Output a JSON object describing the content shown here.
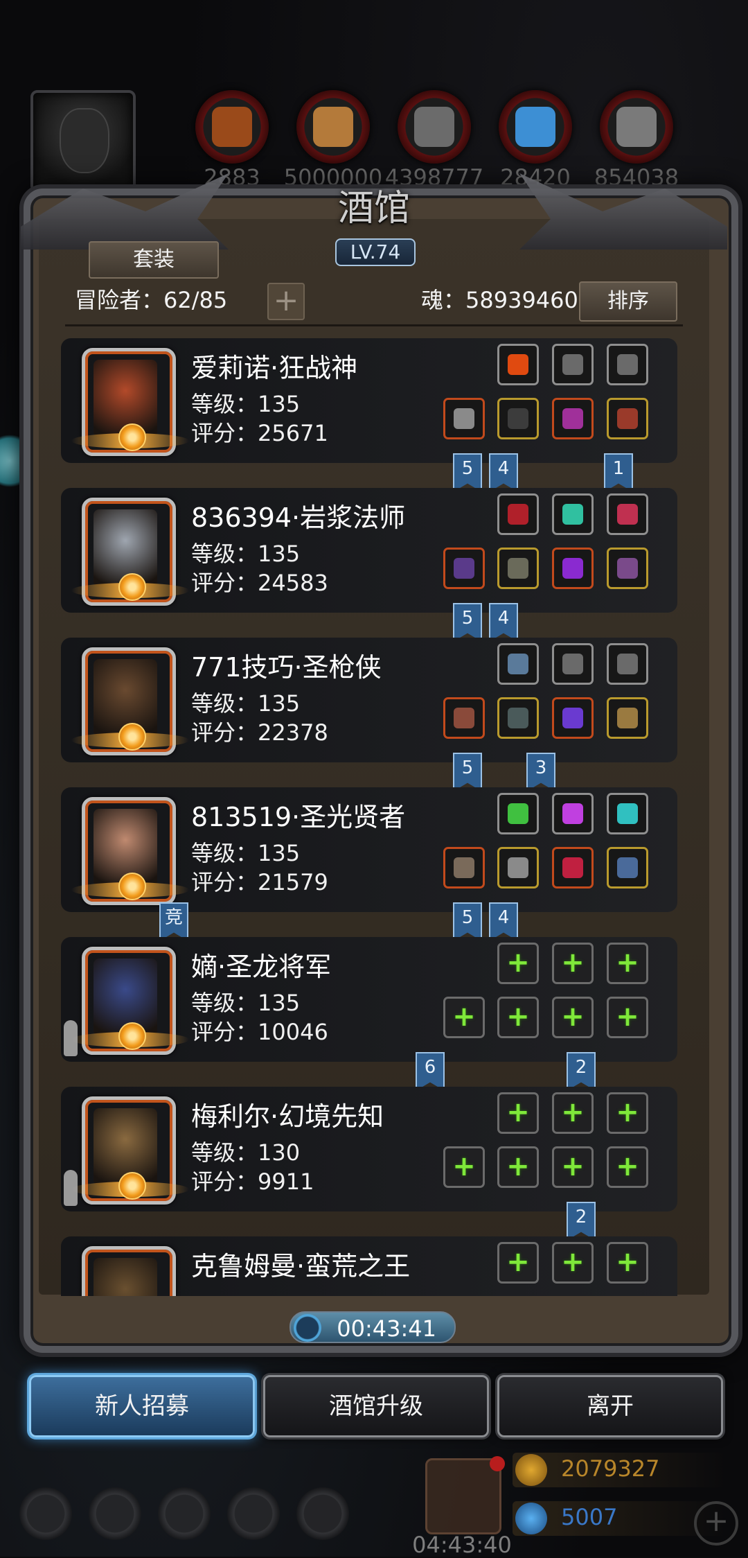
{
  "header": {
    "resources": [
      {
        "icon": "meat-icon",
        "value": "2883",
        "color": "#9a4a1a"
      },
      {
        "icon": "wood-icon",
        "value": "5000000",
        "color": "#b47a3a"
      },
      {
        "icon": "iron-icon",
        "value": "4398777",
        "color": "#6b6b6b"
      },
      {
        "icon": "crystal-icon",
        "value": "28420",
        "color": "#3d8fd4"
      },
      {
        "icon": "stone-icon",
        "value": "854038",
        "color": "#7a7a7a"
      }
    ]
  },
  "tavern": {
    "title": "酒馆",
    "level": "LV.74",
    "set_button": "套装",
    "adventurer_label": "冒险者：62/85",
    "add_button": "+",
    "soul_label": "魂：58939460",
    "sort_button": "排序"
  },
  "heroes": [
    {
      "name": "爱莉诺·狂战神",
      "level": "等级：135",
      "score": "评分：25671",
      "face": "#b34a2a",
      "top_slots": [
        "#e04a10",
        "#6a6a6a",
        "#6a6a6a"
      ],
      "bottom_slots": [
        "#8a8a8a",
        "#3c3c3c",
        "#a0309a",
        "#9a3a2a"
      ],
      "tags": [
        {
          "pos": "a",
          "text": "5"
        },
        {
          "pos": "b",
          "text": "4"
        },
        {
          "pos": "d",
          "text": "1"
        }
      ]
    },
    {
      "name": "836394·岩浆法师",
      "level": "等级：135",
      "score": "评分：24583",
      "face": "#9fa6b0",
      "top_slots": [
        "#b0202a",
        "#30c0a0",
        "#c03050"
      ],
      "bottom_slots": [
        "#5a3a8a",
        "#6a6a5a",
        "#8a2ad0",
        "#7a4a8a"
      ],
      "tags": [
        {
          "pos": "a",
          "text": "5"
        },
        {
          "pos": "b",
          "text": "4"
        }
      ]
    },
    {
      "name": "771技巧·圣枪侠",
      "level": "等级：135",
      "score": "评分：22378",
      "face": "#6a4a30",
      "top_slots": [
        "#5a7a9a",
        "#6a6a6a",
        "#6a6a6a"
      ],
      "bottom_slots": [
        "#8a4a3a",
        "#4a5a5a",
        "#6a3ad0",
        "#9a7a40"
      ],
      "tags": [
        {
          "pos": "a",
          "text": "5"
        },
        {
          "pos": "c",
          "text": "3"
        }
      ]
    },
    {
      "name": "813519·圣光贤者",
      "level": "等级：135",
      "score": "评分：21579",
      "face": "#c08a70",
      "top_slots": [
        "#40c040",
        "#c040e0",
        "#30c0c0"
      ],
      "bottom_slots": [
        "#7a6a5a",
        "#8a8a8a",
        "#c02040",
        "#4a6a9a"
      ],
      "tags": [
        {
          "pos": "x",
          "text": "竞"
        },
        {
          "pos": "a",
          "text": "5"
        },
        {
          "pos": "b",
          "text": "4"
        }
      ]
    },
    {
      "name": "嫡·圣龙将军",
      "level": "等级：135",
      "score": "评分：10046",
      "face": "#3a4a8a",
      "empty": true,
      "runner": true,
      "tags": [
        {
          "pos": "y",
          "text": "6"
        },
        {
          "pos": "c2",
          "text": "2"
        }
      ]
    },
    {
      "name": "梅利尔·幻境先知",
      "level": "等级：130",
      "score": "评分：9911",
      "face": "#8a6a40",
      "empty": true,
      "runner": true,
      "tags": [
        {
          "pos": "c2",
          "text": "2"
        }
      ]
    },
    {
      "name": "克鲁姆曼·蛮荒之王",
      "level": "",
      "score": "",
      "face": "#6a5030",
      "empty": true,
      "runner": false,
      "tags": []
    }
  ],
  "footer": {
    "timer": "00:43:41",
    "recruit_button": "新人招募",
    "upgrade_button": "酒馆升级",
    "leave_button": "离开",
    "gold_value": "2079327",
    "gem_value": "5007",
    "gift_timer": "04:43:40"
  }
}
